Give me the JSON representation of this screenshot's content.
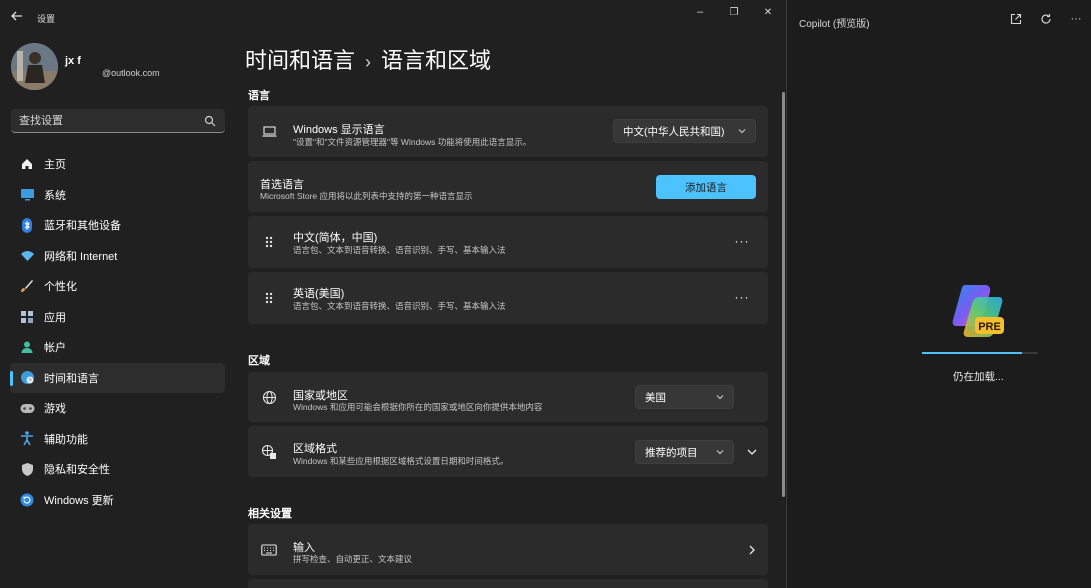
{
  "window": {
    "app_title": "设置",
    "minimize_glyph": "–",
    "maximize_glyph": "❐",
    "close_glyph": "✕"
  },
  "profile": {
    "name": "jx f",
    "email": "@outlook.com"
  },
  "search": {
    "placeholder": "查找设置"
  },
  "nav": {
    "items": [
      {
        "label": "主页",
        "icon": "home-icon"
      },
      {
        "label": "系统",
        "icon": "monitor-icon"
      },
      {
        "label": "蓝牙和其他设备",
        "icon": "bluetooth-icon"
      },
      {
        "label": "网络和 Internet",
        "icon": "wifi-icon"
      },
      {
        "label": "个性化",
        "icon": "brush-icon"
      },
      {
        "label": "应用",
        "icon": "apps-icon"
      },
      {
        "label": "帐户",
        "icon": "person-icon"
      },
      {
        "label": "时间和语言",
        "icon": "globe-clock-icon"
      },
      {
        "label": "游戏",
        "icon": "gamepad-icon"
      },
      {
        "label": "辅助功能",
        "icon": "accessibility-icon"
      },
      {
        "label": "隐私和安全性",
        "icon": "shield-icon"
      },
      {
        "label": "Windows 更新",
        "icon": "update-icon"
      }
    ],
    "active_index": 7
  },
  "breadcrumb": {
    "parent": "时间和语言",
    "separator": "›",
    "current": "语言和区域"
  },
  "sections": {
    "language": "语言",
    "region": "区域",
    "related": "相关设置"
  },
  "display_language": {
    "title": "Windows 显示语言",
    "subtitle": "\"设置\"和\"文件资源管理器\"等 Windows 功能将使用此语言显示。",
    "value": "中文(中华人民共和国)"
  },
  "preferred_languages": {
    "title": "首选语言",
    "subtitle": "Microsoft Store 应用将以此列表中支持的第一种语言显示",
    "add_button": "添加语言",
    "items": [
      {
        "title": "中文(简体，中国)",
        "subtitle": "语言包、文本到语音转换、语音识别、手写、基本输入法"
      },
      {
        "title": "英语(美国)",
        "subtitle": "语言包、文本到语音转换、语音识别、手写、基本输入法"
      }
    ],
    "more_glyph": "···"
  },
  "region_country": {
    "title": "国家或地区",
    "subtitle": "Windows 和应用可能会根据你所在的国家或地区向你提供本地内容",
    "value": "美国"
  },
  "region_format": {
    "title": "区域格式",
    "subtitle": "Windows 和某些应用根据区域格式设置日期和时间格式。",
    "value": "推荐的项目"
  },
  "typing": {
    "title": "输入",
    "subtitle": "拼写检查、自动更正、文本建议"
  },
  "copilot": {
    "title": "Copilot (预览版)",
    "badge": "PRE",
    "loading_text": "仍在加载...",
    "progress": 0.86,
    "more_glyph": "···"
  },
  "colors": {
    "accent": "#4cc2ff",
    "background": "#202020",
    "card": "#2b2b2b"
  }
}
